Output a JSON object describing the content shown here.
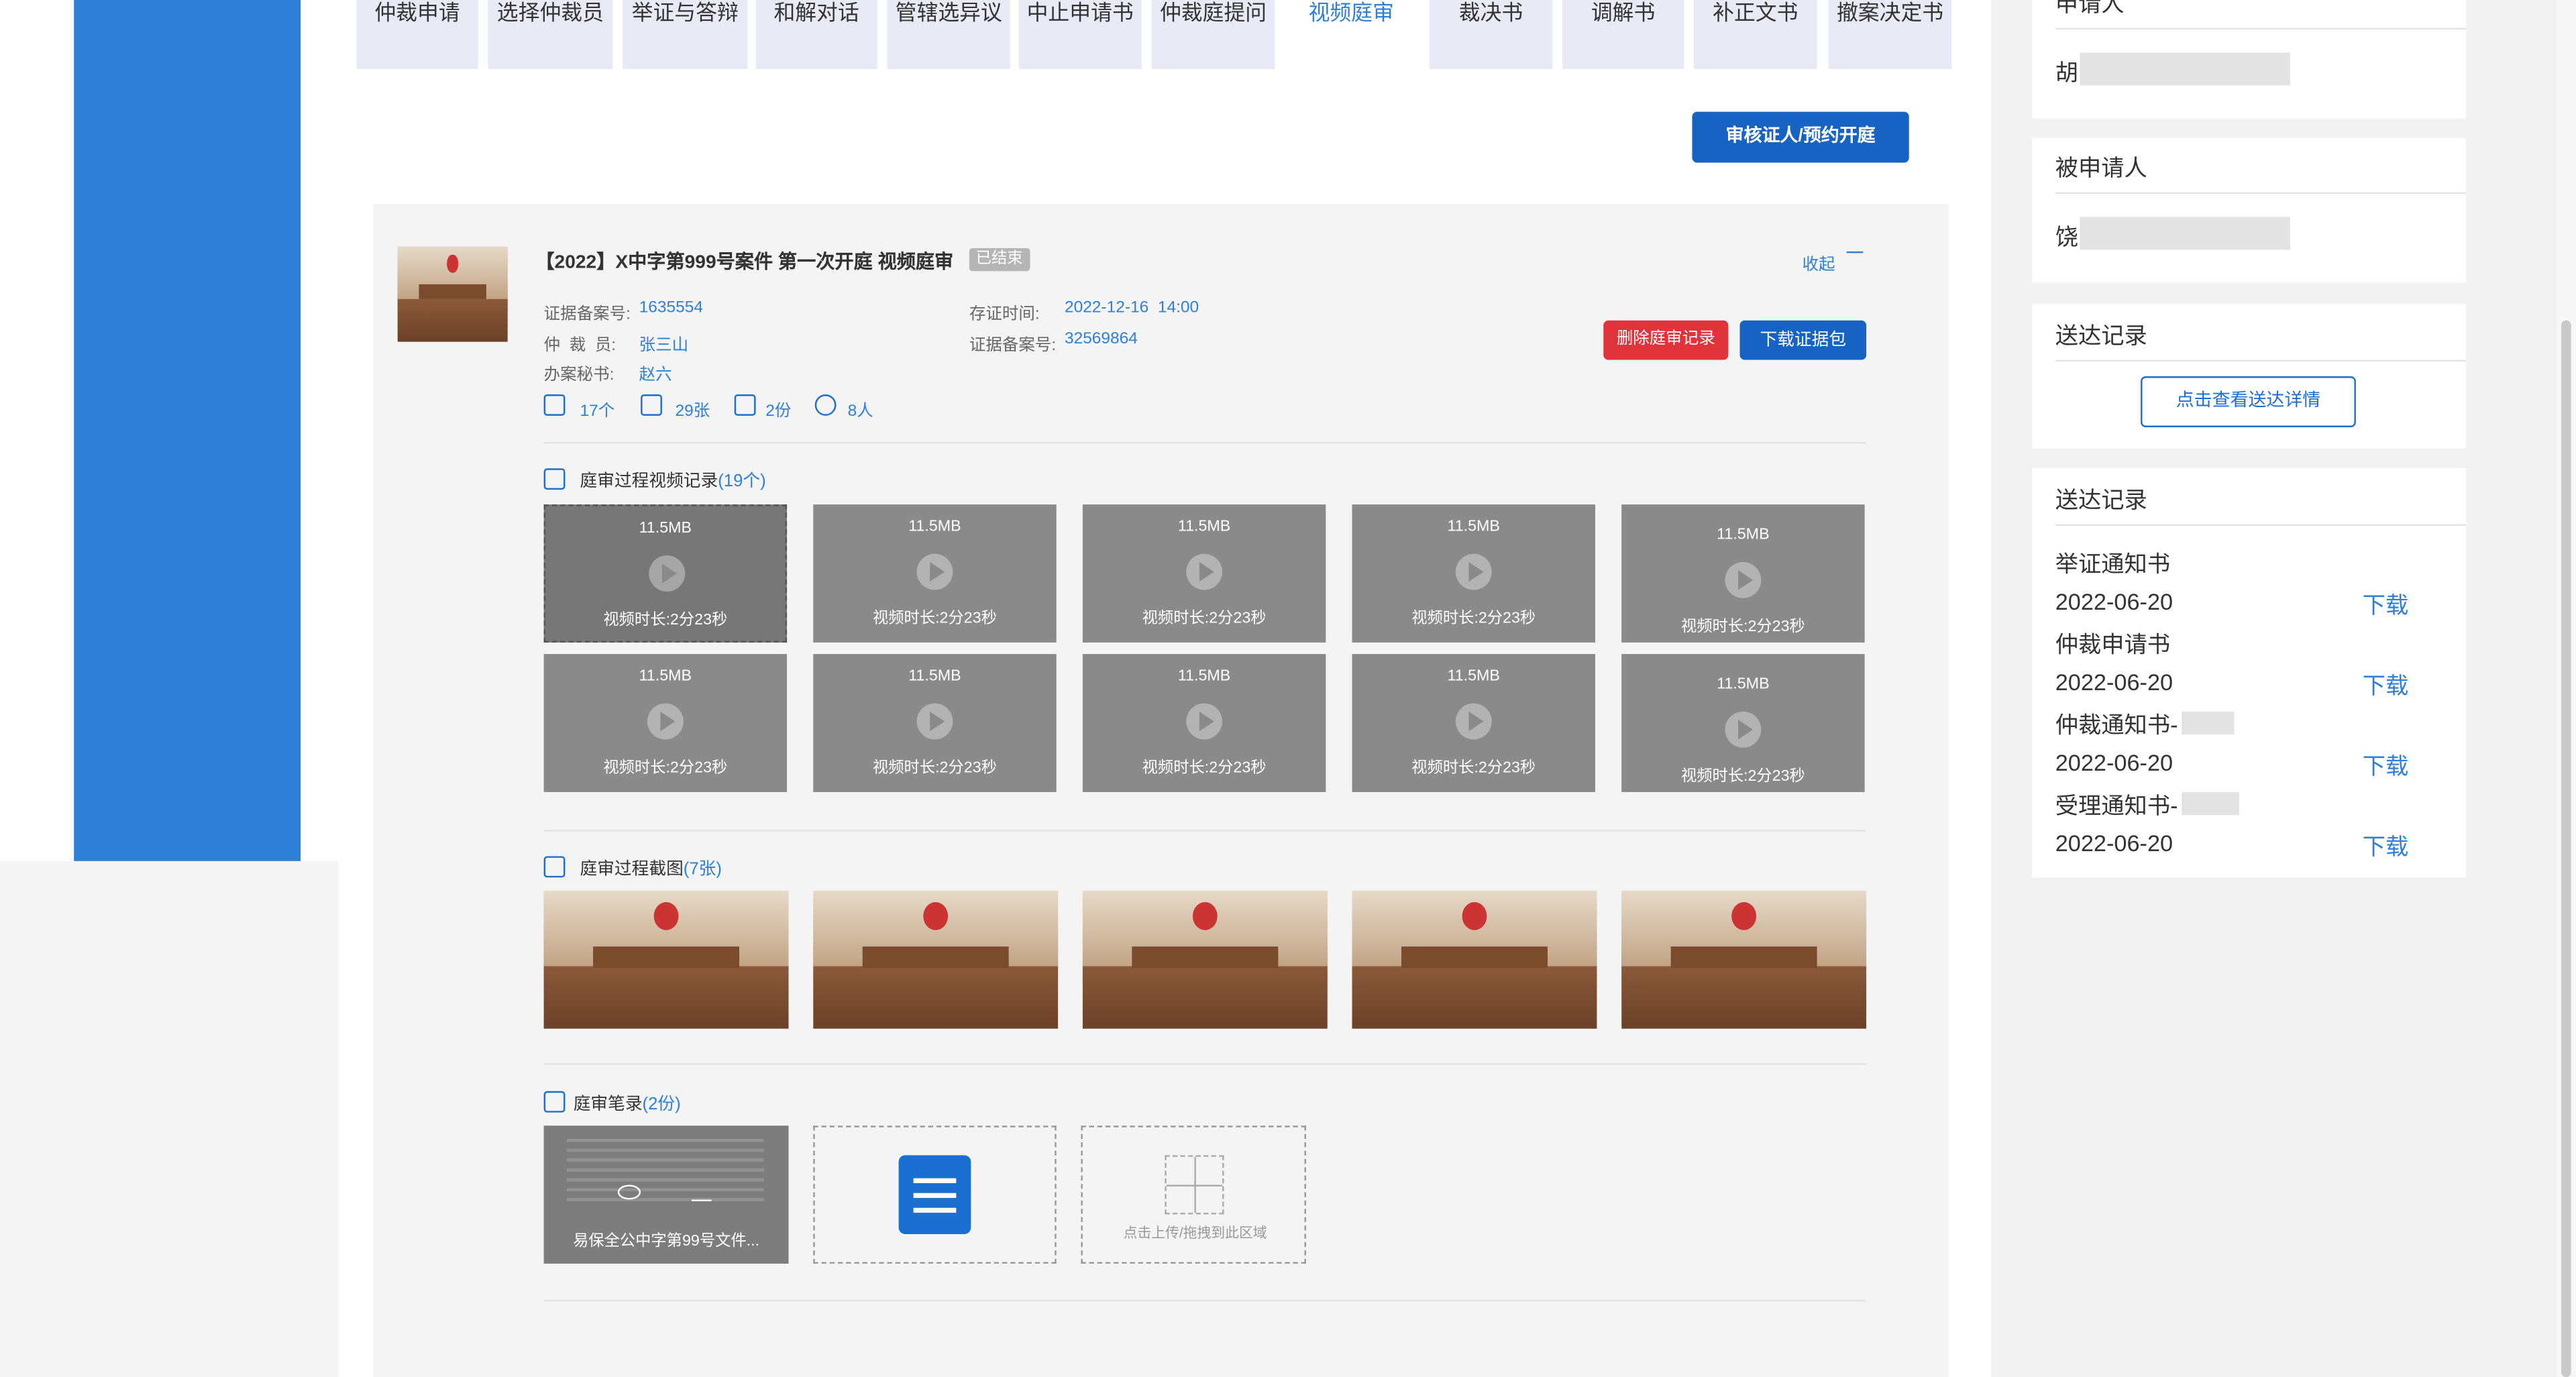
{
  "tabs": [
    "仲裁申请",
    "选择仲裁员",
    "举证与答辩",
    "和解对话",
    "管辖选异议",
    "中止申请书",
    "仲裁庭提问",
    "视频庭审",
    "裁决书",
    "调解书",
    "补正文书",
    "撤案决定书"
  ],
  "active_tab": "视频庭审",
  "top_button": "审核证人/预约开庭",
  "case": {
    "title": "【2022】X中字第999号案件 第一次开庭 视频庭审",
    "status": "已结束",
    "collapse": "收起",
    "fields": {
      "evidence_no_label": "证据备案号:",
      "evidence_no": "1635554",
      "arbitrator_label": "仲  裁  员:",
      "arbitrator": "张三山",
      "secretary_label": "办案秘书:",
      "secretary": "赵六",
      "store_time_label": "存证时间:",
      "store_time": "2022-12-16  14:00",
      "evidence_no2_label": "证据备案号:",
      "evidence_no2": "32569864"
    },
    "stats": {
      "videos": "17个",
      "images": "29张",
      "notes": "2份",
      "people": "8人"
    },
    "delete_button": "删除庭审记录",
    "download_button": "下载证据包"
  },
  "video_section": {
    "title": "庭审过程视频记录",
    "count": "(19个)"
  },
  "videos": {
    "size": "11.5MB",
    "duration": "视频时长:2分23秒"
  },
  "screenshot_section": {
    "title": "庭审过程截图",
    "count": "(7张)"
  },
  "notes_section": {
    "title": "庭审笔录",
    "count": "(2份)"
  },
  "note_file": "易保全公中字第99号文件...",
  "upload_hint": "点击上传/拖拽到此区域",
  "right": {
    "applicant_title": "申请人",
    "applicant_name": "胡",
    "respondent_title": "被申请人",
    "respondent_name": "饶",
    "delivery_title_1": "送达记录",
    "delivery_button": "点击查看送达详情",
    "delivery_title_2": "送达记录",
    "docs": [
      {
        "name": "举证通知书",
        "date": "2022-06-20",
        "action": "下载"
      },
      {
        "name": "仲裁申请书",
        "date": "2022-06-20",
        "action": "下载"
      },
      {
        "name": "仲裁通知书-",
        "date": "2022-06-20",
        "action": "下载"
      },
      {
        "name": "受理通知书-",
        "date": "2022-06-20",
        "action": "下载"
      }
    ]
  }
}
